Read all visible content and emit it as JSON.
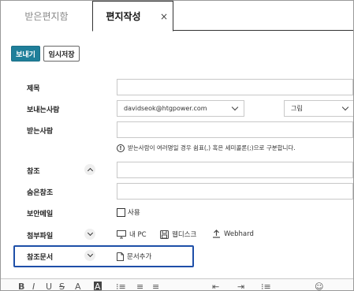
{
  "tabs": {
    "inbox": "받은편지함",
    "compose": "편지작성",
    "close": "×"
  },
  "toolbar": {
    "send_label": "보내기",
    "draft_label": "임시저장"
  },
  "form": {
    "subject_label": "제목",
    "sender_label": "보내는사람",
    "sender_value": "davidseok@htgpower.com",
    "group_value": "그림",
    "to_label": "받는사람",
    "to_hint": "받는사람이 여러명일 경우 쉼표(,) 혹은 세미콜론(;)으로 구분합니다.",
    "cc_label": "참조",
    "bcc_label": "숨은참조",
    "secure_label": "보안메일",
    "secure_option": "사용",
    "attach_label": "첨부파일",
    "attach_mypc": "내 PC",
    "attach_webdisk": "웹디스크",
    "attach_webhard": "Webhard",
    "refdoc_label": "참조문서",
    "refdoc_add": "문서추가"
  },
  "editor": {
    "tools": [
      "B",
      "I",
      "U",
      "S",
      "A",
      "A",
      "⁝≡",
      "≡",
      "≡",
      "⇤",
      "⇥",
      "⁝≡",
      "☺"
    ]
  }
}
